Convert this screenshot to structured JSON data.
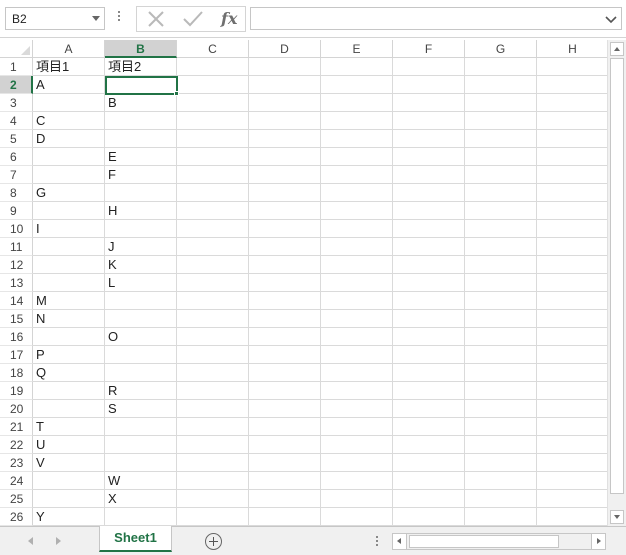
{
  "name_box": {
    "value": "B2"
  },
  "formula_bar": {
    "fx_label": "fx",
    "value": ""
  },
  "columns": [
    "A",
    "B",
    "C",
    "D",
    "E",
    "F",
    "G",
    "H"
  ],
  "selected_column": "B",
  "rows": [
    {
      "num": "1",
      "a": "項目1",
      "b": "項目2"
    },
    {
      "num": "2",
      "a": "A",
      "b": ""
    },
    {
      "num": "3",
      "a": "",
      "b": "B"
    },
    {
      "num": "4",
      "a": "C",
      "b": ""
    },
    {
      "num": "5",
      "a": "D",
      "b": ""
    },
    {
      "num": "6",
      "a": "",
      "b": "E"
    },
    {
      "num": "7",
      "a": "",
      "b": "F"
    },
    {
      "num": "8",
      "a": "G",
      "b": ""
    },
    {
      "num": "9",
      "a": "",
      "b": "H"
    },
    {
      "num": "10",
      "a": "I",
      "b": ""
    },
    {
      "num": "11",
      "a": "",
      "b": "J"
    },
    {
      "num": "12",
      "a": "",
      "b": "K"
    },
    {
      "num": "13",
      "a": "",
      "b": "L"
    },
    {
      "num": "14",
      "a": "M",
      "b": ""
    },
    {
      "num": "15",
      "a": "N",
      "b": ""
    },
    {
      "num": "16",
      "a": "",
      "b": "O"
    },
    {
      "num": "17",
      "a": "P",
      "b": ""
    },
    {
      "num": "18",
      "a": "Q",
      "b": ""
    },
    {
      "num": "19",
      "a": "",
      "b": "R"
    },
    {
      "num": "20",
      "a": "",
      "b": "S"
    },
    {
      "num": "21",
      "a": "T",
      "b": ""
    },
    {
      "num": "22",
      "a": "U",
      "b": ""
    },
    {
      "num": "23",
      "a": "V",
      "b": ""
    },
    {
      "num": "24",
      "a": "",
      "b": "W"
    },
    {
      "num": "25",
      "a": "",
      "b": "X"
    },
    {
      "num": "26",
      "a": "Y",
      "b": ""
    }
  ],
  "selected_row": "2",
  "sheet_tabs": [
    {
      "label": "Sheet1",
      "active": true
    }
  ],
  "colors": {
    "accent": "#217346",
    "header_selected_bg": "#d2d2d2",
    "gridline": "#dadada"
  },
  "icons": {
    "cancel": "close-x-icon",
    "enter": "checkmark-icon",
    "add_sheet": "plus-circle-icon"
  }
}
